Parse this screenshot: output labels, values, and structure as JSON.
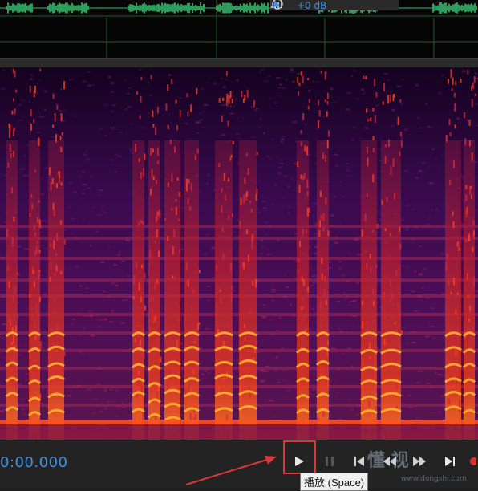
{
  "waveform_toolbar": {
    "volume_readout": "+0 dB",
    "icons": [
      "signal-bars-icon",
      "volume-knob-icon",
      "pin-icon"
    ]
  },
  "transport": {
    "time_display": "0:00.000",
    "buttons": {
      "play": "play-icon",
      "pause": "pause-icon",
      "go_to_start": "skip-to-start-icon",
      "rewind": "rewind-icon",
      "fast_forward": "fast-forward-icon",
      "go_to_end": "skip-to-end-icon",
      "record": "record-icon"
    },
    "play_tooltip": "播放 (Space)"
  },
  "watermark": {
    "text": "懂 视",
    "url": "www.dongshi.com"
  },
  "colors": {
    "time_blue": "#3d93e8",
    "highlight_red": "#d93838",
    "waveform_green": "#3ecf7a",
    "record_red": "#e03030"
  }
}
